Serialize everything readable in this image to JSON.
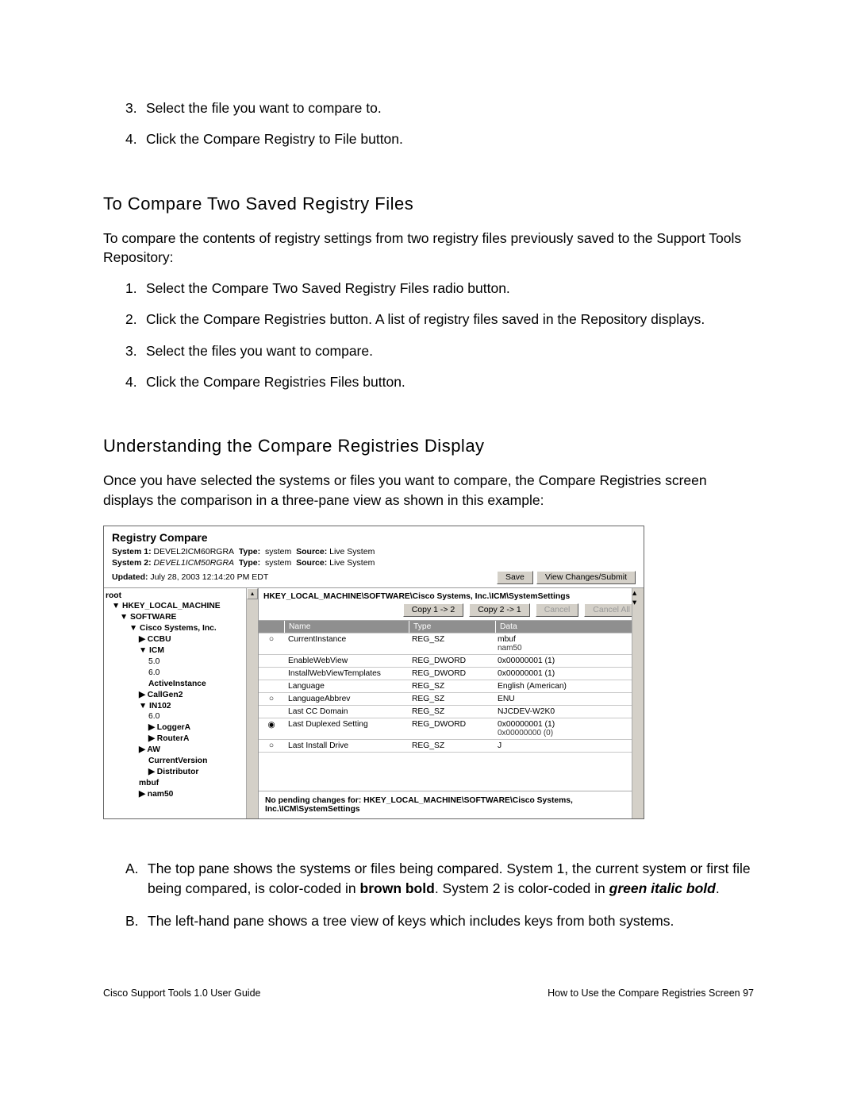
{
  "top_steps": [
    "Select the file you want to compare to.",
    "Click the Compare Registry to File button."
  ],
  "heading_compare": "To Compare Two Saved Registry Files",
  "para_compare_intro": "To compare the contents of registry settings from two registry files previously saved to the Support Tools Repository:",
  "compare_steps": [
    "Select the Compare Two Saved Registry Files radio button.",
    "Click the Compare Registries button. A list of registry files saved in the Repository displays.",
    "Select the files you want to compare.",
    "Click the Compare Registries Files button."
  ],
  "heading_understanding": "Understanding the Compare Registries Display",
  "para_understanding_intro": "Once you have selected the systems or files you want to compare, the Compare Registries screen displays the comparison in a three-pane view as shown in this example:",
  "fig": {
    "title": "Registry Compare",
    "sys1_label": "System 1:",
    "sys1_name": "DEVEL2ICM60RGRA",
    "sys2_label": "System 2:",
    "sys2_name": "DEVEL1ICM50RGRA",
    "type_label": "Type:",
    "type_value": "system",
    "source_label": "Source:",
    "source_value": "Live System",
    "updated_label": "Updated:",
    "updated_value": "July 28, 2003 12:14:20 PM EDT",
    "btn_save": "Save",
    "btn_view": "View Changes/Submit",
    "tree": [
      {
        "text": "root",
        "cls": "bold"
      },
      {
        "text": "▼ HKEY_LOCAL_MACHINE",
        "cls": "bold pad1"
      },
      {
        "text": "▼ SOFTWARE",
        "cls": "bold pad2"
      },
      {
        "text": "▼ Cisco Systems, Inc.",
        "cls": "bold pad3"
      },
      {
        "text": "▶ CCBU",
        "cls": "bold pad4"
      },
      {
        "text": "▼ ICM",
        "cls": "bold pad4"
      },
      {
        "text": "5.0",
        "cls": "pad5"
      },
      {
        "text": "6.0",
        "cls": "pad5"
      },
      {
        "text": "ActiveInstance",
        "cls": "bold pad5"
      },
      {
        "text": "▶ CallGen2",
        "cls": "bold pad4"
      },
      {
        "text": "▼ IN102",
        "cls": "bold pad4"
      },
      {
        "text": "6.0",
        "cls": "pad5"
      },
      {
        "text": "▶ LoggerA",
        "cls": "bold pad5"
      },
      {
        "text": "▶ RouterA",
        "cls": "bold pad5"
      },
      {
        "text": "▶ AW",
        "cls": "bold pad4"
      },
      {
        "text": "CurrentVersion",
        "cls": "bold pad5"
      },
      {
        "text": "▶ Distributor",
        "cls": "bold pad5"
      },
      {
        "text": "mbuf",
        "cls": "bold pad4"
      },
      {
        "text": "▶ nam50",
        "cls": "bold pad4"
      }
    ],
    "rp_path": "HKEY_LOCAL_MACHINE\\SOFTWARE\\Cisco Systems, Inc.\\ICM\\SystemSettings",
    "btn_copy12": "Copy 1 -> 2",
    "btn_copy21": "Copy 2 -> 1",
    "btn_cancel": "Cancel",
    "btn_cancel_all": "Cancel All",
    "cols": {
      "name": "Name",
      "type": "Type",
      "data": "Data"
    },
    "rows": [
      {
        "radio": "○",
        "name": "CurrentInstance",
        "type": "REG_SZ",
        "data": "mbuf",
        "data2": "nam50"
      },
      {
        "radio": "",
        "name": "EnableWebView",
        "type": "REG_DWORD",
        "data": "0x00000001 (1)"
      },
      {
        "radio": "",
        "name": "InstallWebViewTemplates",
        "type": "REG_DWORD",
        "data": "0x00000001 (1)"
      },
      {
        "radio": "",
        "name": "Language",
        "type": "REG_SZ",
        "data": "English (American)"
      },
      {
        "radio": "○",
        "name": "LanguageAbbrev",
        "type": "REG_SZ",
        "data": "ENU"
      },
      {
        "radio": "",
        "name": "Last CC Domain",
        "type": "REG_SZ",
        "data": "NJCDEV-W2K0"
      },
      {
        "radio": "◉",
        "name": "Last Duplexed Setting",
        "type": "REG_DWORD",
        "data": "0x00000001 (1)",
        "data2": "0x00000000 (0)"
      },
      {
        "radio": "○",
        "name": "Last Install Drive",
        "type": "REG_SZ",
        "data": "J"
      }
    ],
    "status": "No pending changes for: HKEY_LOCAL_MACHINE\\SOFTWARE\\Cisco Systems, Inc.\\ICM\\SystemSettings"
  },
  "annot_a_pre": "The top pane shows the systems or files being compared. System 1, the current system or first file being compared, is color-coded in ",
  "annot_a_brown": "brown bold",
  "annot_a_mid": ". System 2 is color-coded in ",
  "annot_a_green": "green italic bold",
  "annot_a_post": ".",
  "annot_b": "The left-hand pane shows a tree view of keys which includes keys from both systems.",
  "footer_left": "Cisco Support Tools 1.0 User Guide",
  "footer_right": "How to Use the Compare Registries Screen   97"
}
